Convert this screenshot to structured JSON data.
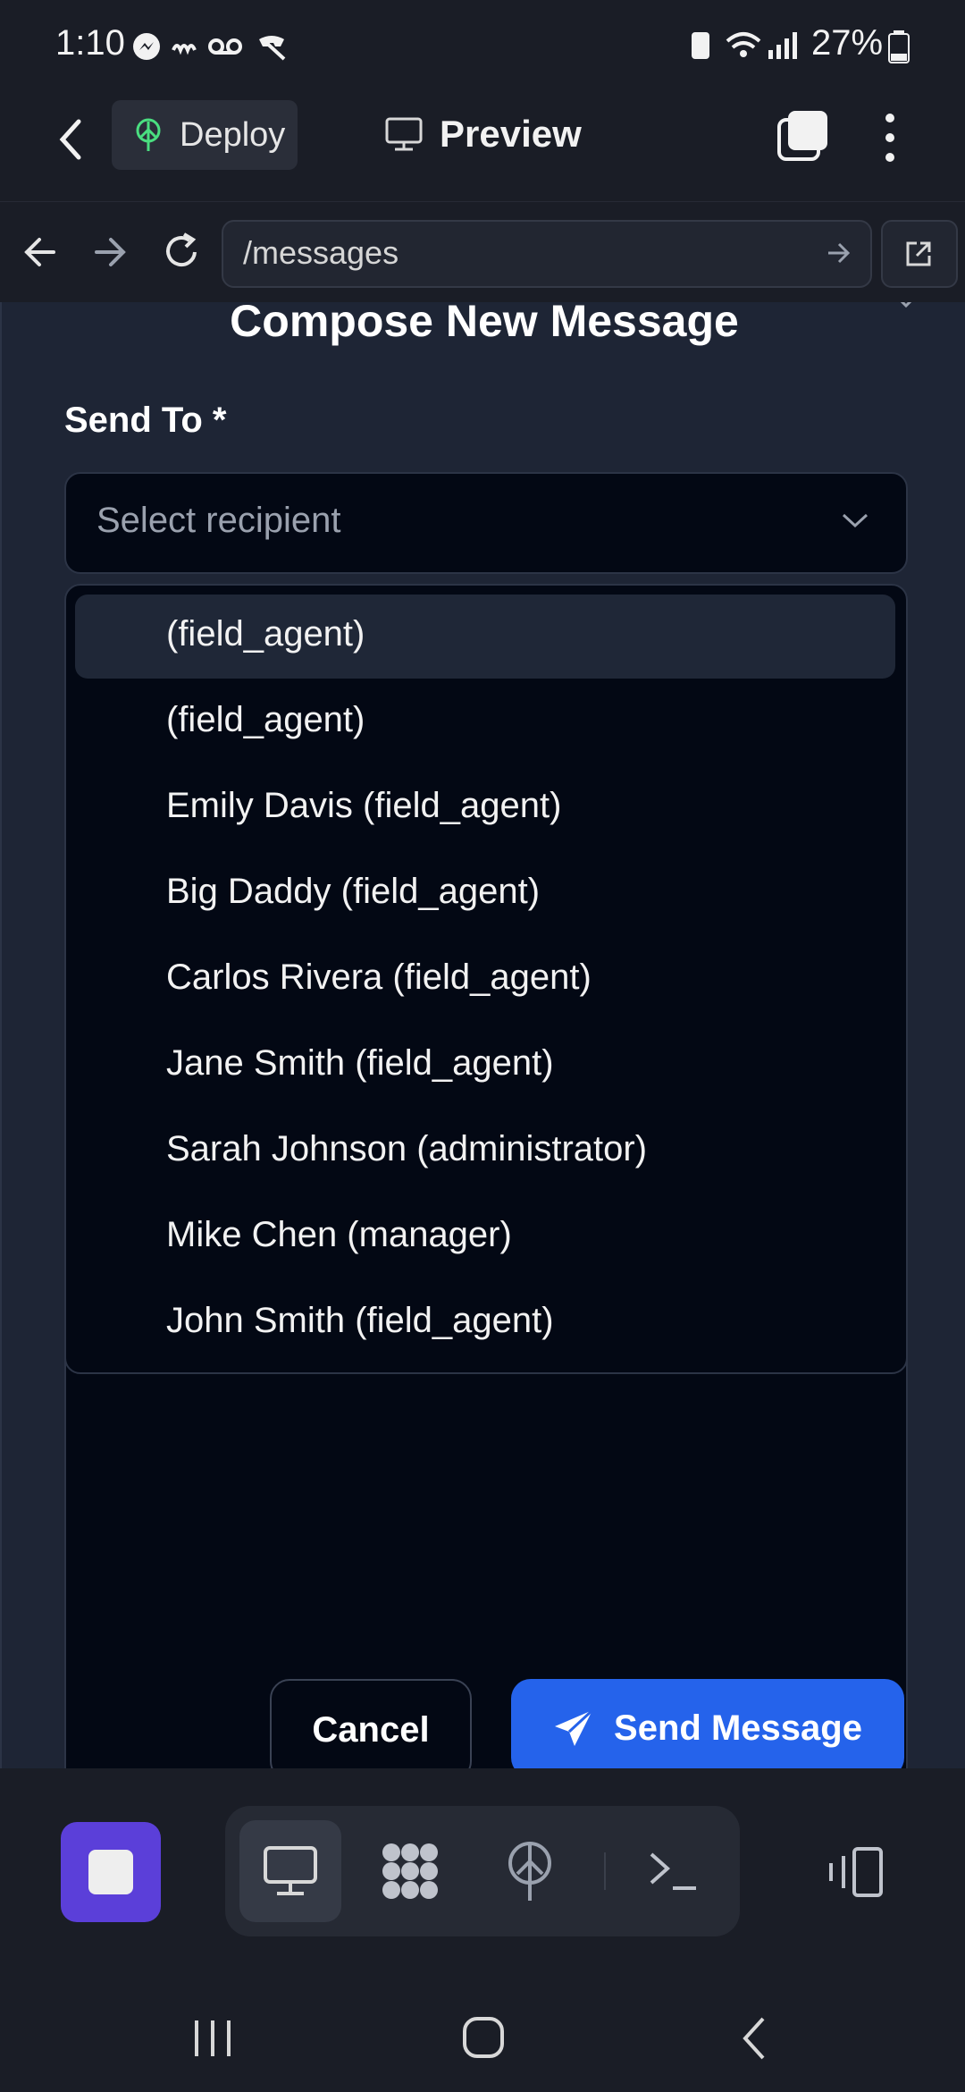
{
  "status_bar": {
    "time": "1:10",
    "battery": "27%"
  },
  "toolbar": {
    "deploy_label": "Deploy",
    "preview_label": "Preview"
  },
  "browser": {
    "url": "/messages"
  },
  "modal": {
    "title": "Compose New Message",
    "send_to_label": "Send To *",
    "select_placeholder": "Select recipient",
    "options": [
      "(field_agent)",
      "(field_agent)",
      "Emily Davis (field_agent)",
      "Big Daddy (field_agent)",
      "Carlos Rivera (field_agent)",
      "Jane Smith (field_agent)",
      "Sarah Johnson (administrator)",
      "Mike Chen (manager)",
      "John Smith (field_agent)"
    ],
    "cancel_label": "Cancel",
    "send_label": "Send Message"
  },
  "colors": {
    "primary": "#2563eb",
    "stop": "#5b3fd9",
    "background": "#1a1d26"
  },
  "icons": [
    "back-icon",
    "deploy-icon",
    "monitor-icon",
    "tabs-icon",
    "more-icon",
    "arrow-left-icon",
    "arrow-right-icon",
    "reload-icon",
    "open-external-icon",
    "chevron-down-icon",
    "close-icon",
    "send-icon",
    "stop-icon",
    "desktop-icon",
    "grid-icon",
    "antenna-icon",
    "terminal-icon",
    "device-icon"
  ]
}
